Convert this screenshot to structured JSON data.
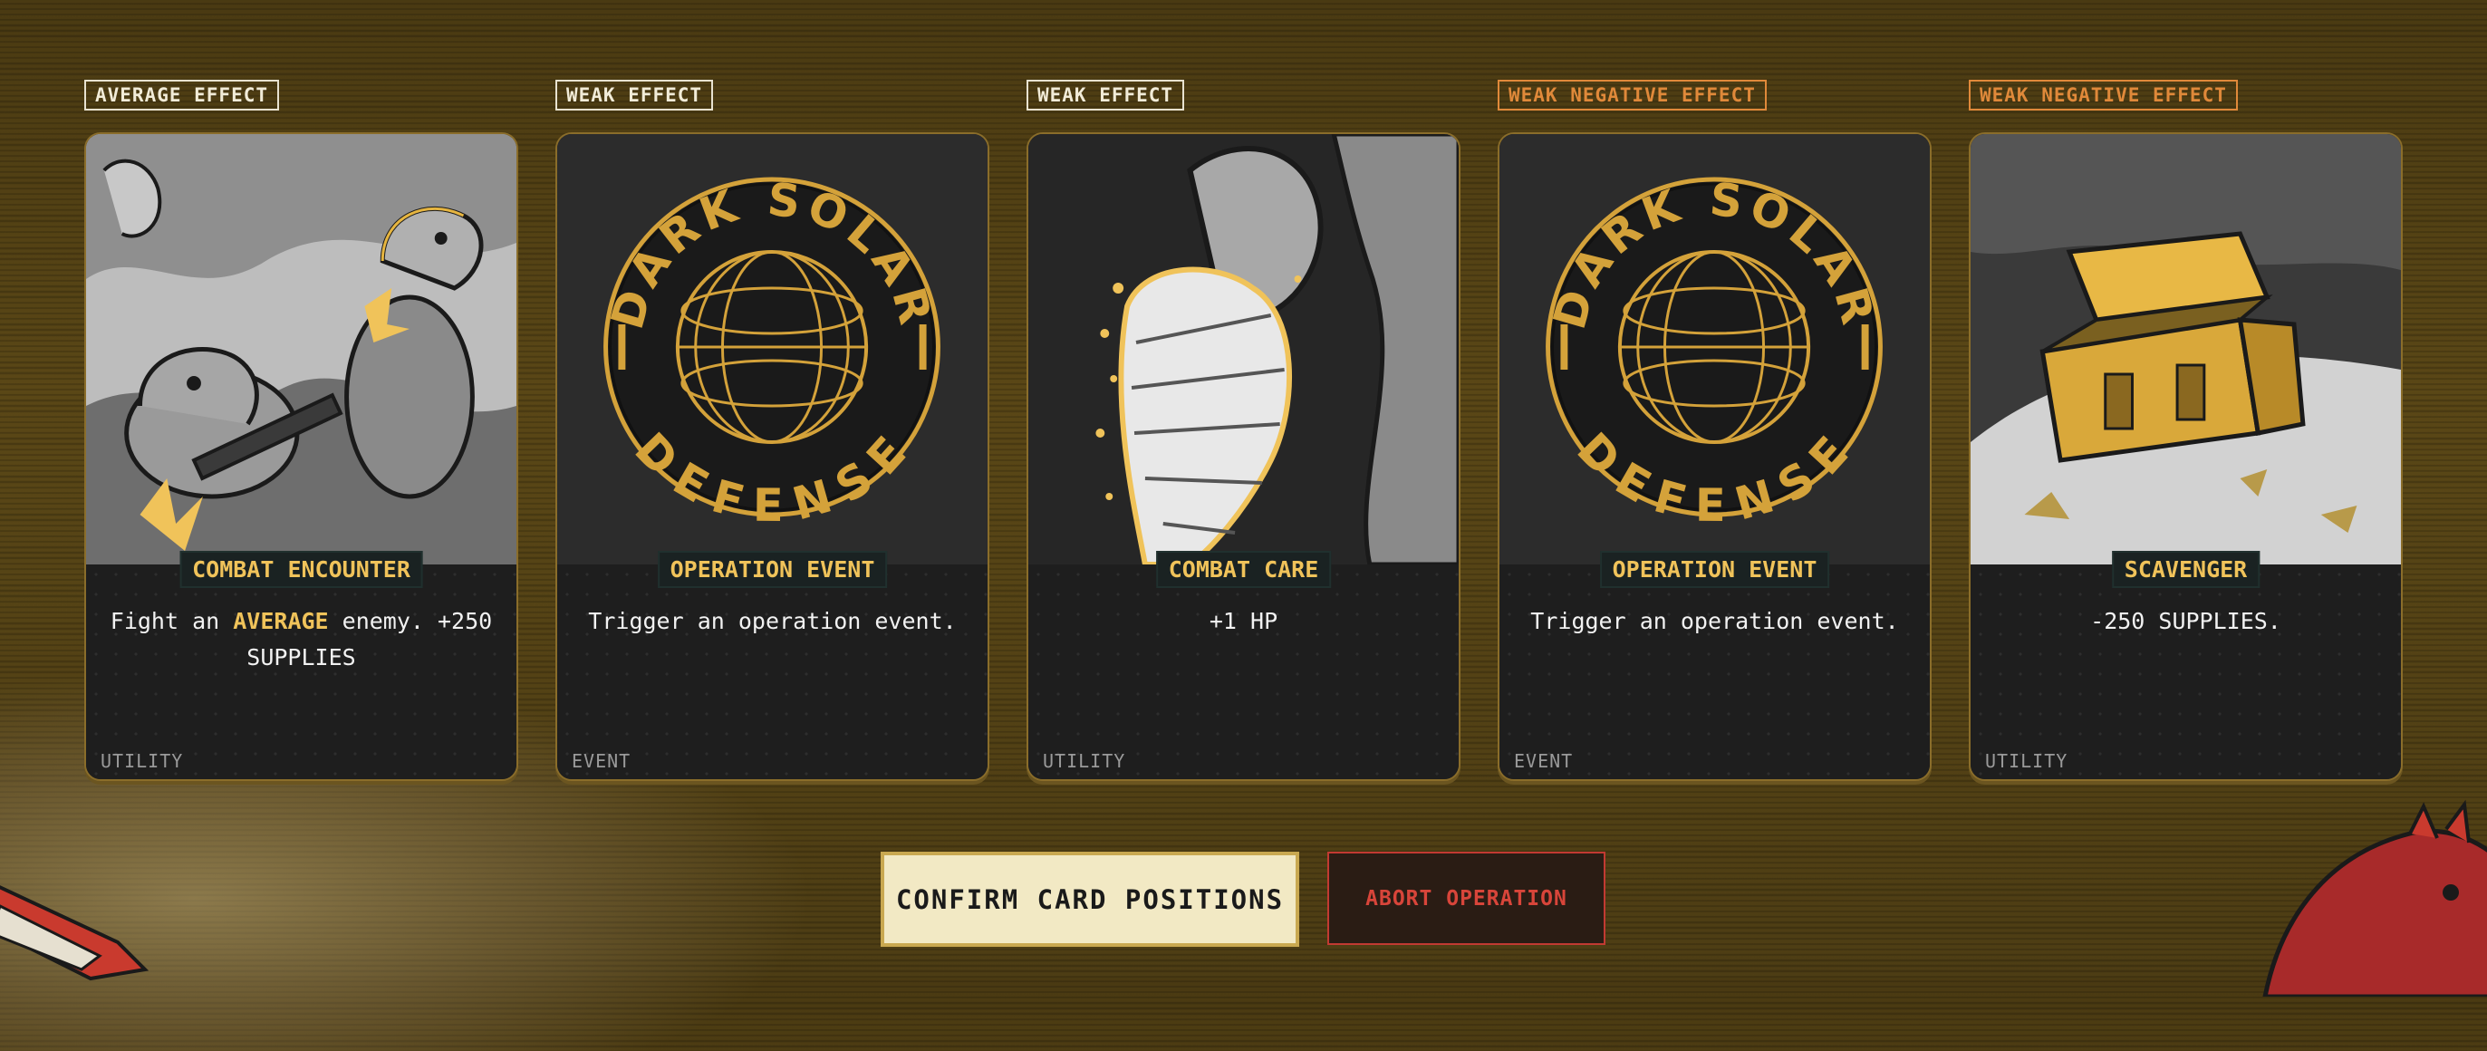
{
  "cards": [
    {
      "tag": "AVERAGE EFFECT",
      "tag_style": "neutral",
      "title": "COMBAT ENCOUNTER",
      "desc_pre": "Fight an ",
      "desc_hl": "AVERAGE",
      "desc_post": " enemy. +250 SUPPLIES",
      "type": "UTILITY",
      "art": "dino-soldiers"
    },
    {
      "tag": "WEAK EFFECT",
      "tag_style": "neutral",
      "title": "OPERATION EVENT",
      "desc": "Trigger an operation event.",
      "type": "EVENT",
      "art": "dark-solar-defense-emblem"
    },
    {
      "tag": "WEAK EFFECT",
      "tag_style": "neutral",
      "title": "COMBAT CARE",
      "desc": "+1 HP",
      "type": "UTILITY",
      "art": "bandaged-arm"
    },
    {
      "tag": "WEAK NEGATIVE EFFECT",
      "tag_style": "negative",
      "title": "OPERATION EVENT",
      "desc": "Trigger an operation event.",
      "type": "EVENT",
      "art": "dark-solar-defense-emblem"
    },
    {
      "tag": "WEAK NEGATIVE EFFECT",
      "tag_style": "negative",
      "title": "SCAVENGER",
      "desc": "-250 SUPPLIES.",
      "type": "UTILITY",
      "art": "supply-crate"
    }
  ],
  "emblem": {
    "top_text": "DARK SOLAR",
    "bottom_text": "DEFENSE"
  },
  "buttons": {
    "confirm": "CONFIRM CARD POSITIONS",
    "abort": "ABORT OPERATION"
  },
  "colors": {
    "accent": "#f0c35a",
    "negative": "#e0893a",
    "abort": "#d8453a"
  }
}
